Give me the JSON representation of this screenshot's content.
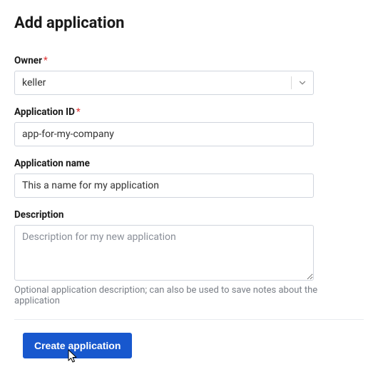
{
  "title": "Add application",
  "fields": {
    "owner": {
      "label": "Owner",
      "required": true,
      "value": "keller"
    },
    "app_id": {
      "label": "Application ID",
      "required": true,
      "value": "app-for-my-company"
    },
    "app_name": {
      "label": "Application name",
      "value": "This a name for my application"
    },
    "description": {
      "label": "Description",
      "placeholder": "Description for my new application",
      "help": "Optional application description; can also be used to save notes about the application"
    }
  },
  "actions": {
    "submit": "Create application"
  },
  "required_mark": "*"
}
